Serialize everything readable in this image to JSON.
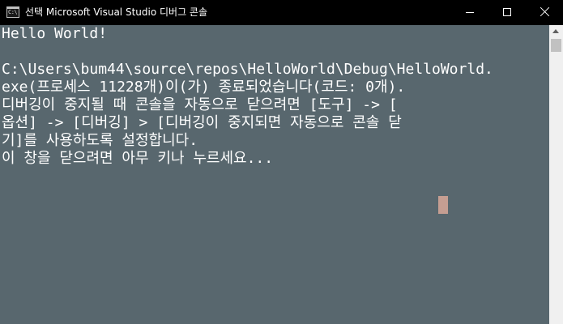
{
  "window": {
    "title": "선택 Microsoft Visual Studio 디버그 콘솔",
    "icon_text": "C:\\",
    "icon_name": "console-app-icon",
    "titlebar_color": "#000000",
    "console_background": "#58676e",
    "console_text_color": "#ffffff",
    "cursor_color": "#c59e92"
  },
  "controls": {
    "minimize_icon": "minimize-icon",
    "maximize_icon": "maximize-icon",
    "close_icon": "close-icon"
  },
  "console": {
    "lines": [
      "Hello World!",
      "C:\\Users\\bum44\\source\\repos\\HelloWorld\\Debug\\HelloWorld.",
      "exe(프로세스 11228개)이(가) 종료되었습니다(코드: 0개).",
      "디버깅이 중지될 때 콘솔을 자동으로 닫으려면 [도구] -> [",
      "옵션] -> [디버깅] > [디버깅이 중지되면 자동으로 콘솔 닫",
      "기]를 사용하도록 설정합니다.",
      "이 창을 닫으려면 아무 키나 누르세요..."
    ]
  },
  "scrollbar": {
    "up_arrow_icon": "scroll-up-arrow-icon"
  }
}
